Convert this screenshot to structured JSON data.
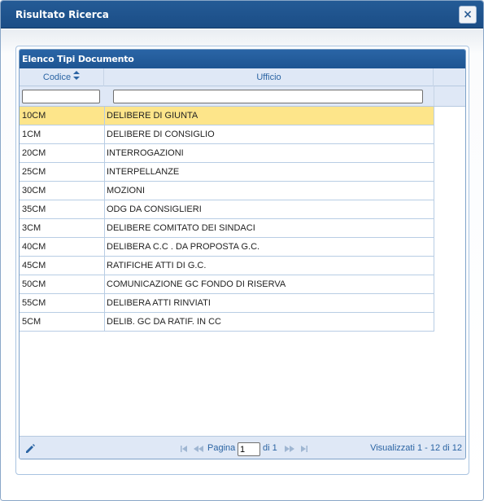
{
  "dialog": {
    "title": "Risultato Ricerca",
    "close_label": "×"
  },
  "grid": {
    "caption": "Elenco Tipi Documento",
    "columns": {
      "codice": "Codice",
      "ufficio": "Ufficio"
    },
    "filters": {
      "codice_value": "",
      "ufficio_value": ""
    },
    "rows": [
      {
        "code": "10CM",
        "ufficio": "DELIBERE DI GIUNTA",
        "selected": true
      },
      {
        "code": "1CM",
        "ufficio": "DELIBERE DI CONSIGLIO"
      },
      {
        "code": "20CM",
        "ufficio": "INTERROGAZIONI"
      },
      {
        "code": "25CM",
        "ufficio": "INTERPELLANZE"
      },
      {
        "code": "30CM",
        "ufficio": "MOZIONI"
      },
      {
        "code": "35CM",
        "ufficio": "ODG DA CONSIGLIERI"
      },
      {
        "code": "3CM",
        "ufficio": "DELIBERE COMITATO DEI SINDACI"
      },
      {
        "code": "40CM",
        "ufficio": "DELIBERA C.C . DA PROPOSTA G.C."
      },
      {
        "code": "45CM",
        "ufficio": "RATIFICHE  ATTI  DI G.C."
      },
      {
        "code": "50CM",
        "ufficio": "COMUNICAZIONE GC FONDO DI RISERVA"
      },
      {
        "code": "55CM",
        "ufficio": "DELIBERA ATTI RINVIATI"
      },
      {
        "code": "5CM",
        "ufficio": "DELIB. GC DA RATIF. IN CC"
      }
    ]
  },
  "pager": {
    "page_label": "Pagina",
    "page_value": "1",
    "of_label": "di 1",
    "records_label": "Visualizzati 1 - 12 di 12"
  },
  "colors": {
    "header_blue": "#1e5592",
    "selected_row": "#fde58a",
    "pager_text": "#2b64a3"
  }
}
